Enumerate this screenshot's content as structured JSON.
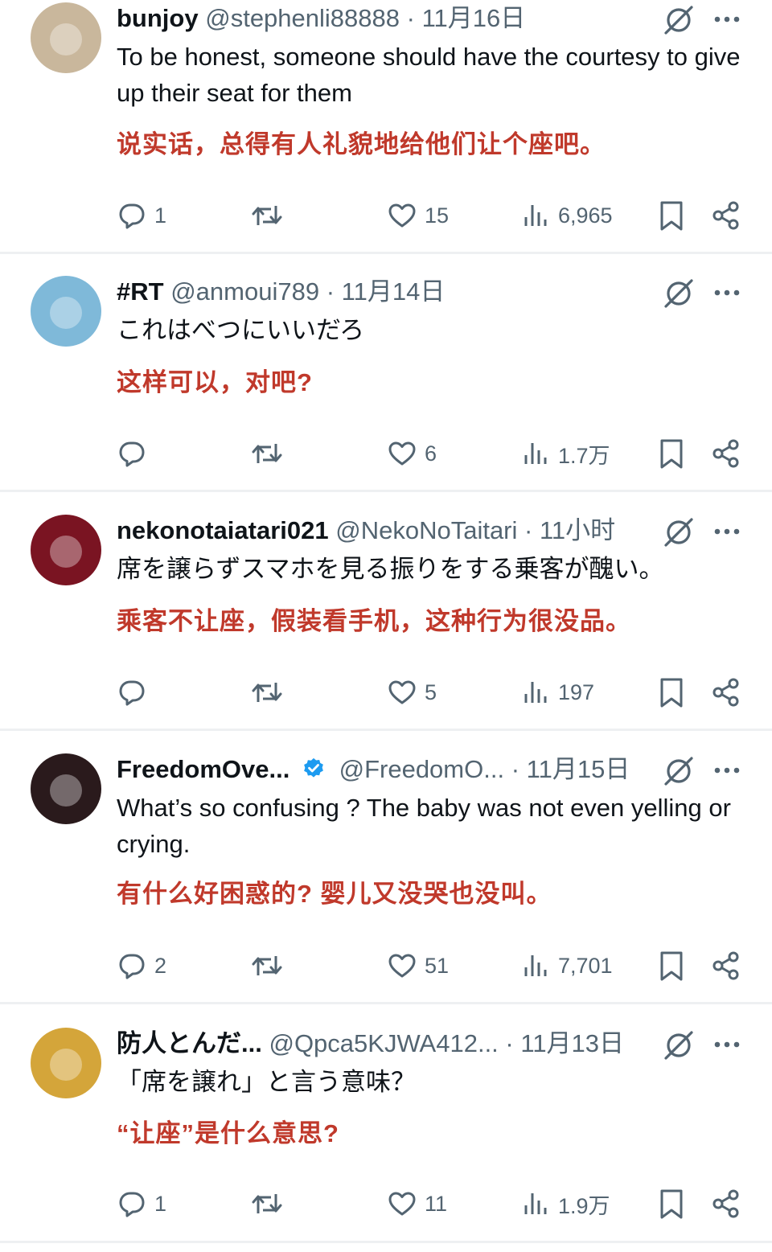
{
  "tweets": [
    {
      "name": "bunjoy",
      "handle": "@stephenli88888",
      "sep": "·",
      "time": "11月16日",
      "text": "To be honest, someone should have the courtesy to give up their seat for them",
      "translation": "说实话，总得有人礼貌地给他们让个座吧。",
      "replies": "1",
      "likes": "15",
      "views": "6,965",
      "verified": false,
      "avatar_color": "#c9b79c"
    },
    {
      "name": "#RT",
      "handle": "@anmoui789",
      "sep": "·",
      "time": "11月14日",
      "text": "これはべつにいいだろ",
      "translation": "这样可以，对吧?",
      "replies": "",
      "likes": "6",
      "views": "1.7万",
      "verified": false,
      "avatar_color": "#7fb9d9"
    },
    {
      "name": "nekonotaiatari021",
      "handle": "@NekoNoTaitari",
      "sep": "·",
      "time": "11小时",
      "text": "席を譲らずスマホを見る振りをする乗客が醜い。",
      "translation": "乘客不让座，假装看手机，这种行为很没品。",
      "replies": "",
      "likes": "5",
      "views": "197",
      "verified": false,
      "avatar_color": "#7a1422"
    },
    {
      "name": "FreedomOve...",
      "handle": "@FreedomO...",
      "sep": "·",
      "time": "11月15日",
      "text": "What’s so confusing ? The baby was not even yelling or crying.",
      "translation": "有什么好困惑的? 婴儿又没哭也没叫。",
      "replies": "2",
      "likes": "51",
      "views": "7,701",
      "verified": true,
      "avatar_color": "#2a1a1c"
    },
    {
      "name": "防人とんだ...",
      "handle": "@Qpca5KJWA412...",
      "sep": "·",
      "time": "11月13日",
      "text": "「席を譲れ」と言う意味？",
      "translation": "“让座”是什么意思?",
      "replies": "1",
      "likes": "11",
      "views": "1.9万",
      "verified": false,
      "avatar_color": "#d4a53a"
    }
  ],
  "icons": {
    "reply": "speech-bubble-icon",
    "retweet": "retweet-icon",
    "like": "heart-icon",
    "views": "bar-chart-icon",
    "bookmark": "bookmark-icon",
    "share": "share-icon",
    "grok": "slashed-circle-icon",
    "more": "more-dots-icon",
    "verified": "verified-badge-icon"
  },
  "colors": {
    "text": "#0f1419",
    "meta": "#536471",
    "translation": "#c0392b",
    "verified": "#1d9bf0"
  }
}
